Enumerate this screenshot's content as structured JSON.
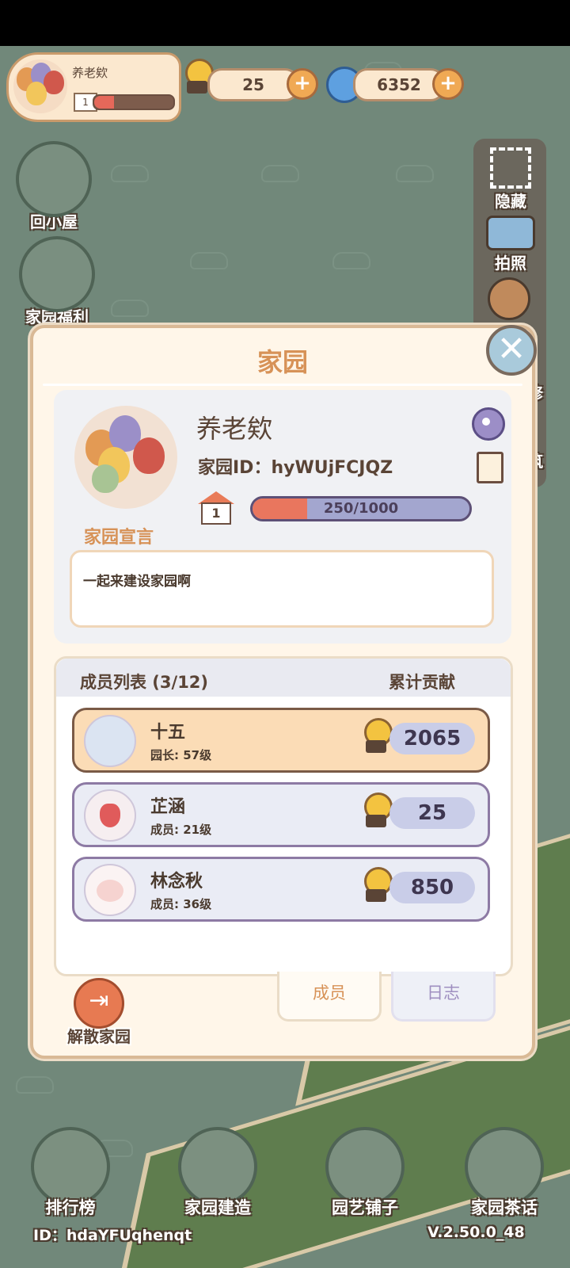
{
  "colors": {
    "accent": "#d79257",
    "leader_row": "#fbdcb6",
    "member_row": "#eaecf5",
    "exp_fill": "#e9765e"
  },
  "hud": {
    "profile_name": "养老欸",
    "profile_level": "1",
    "profile_progress": 0.25,
    "snail_currency": "25",
    "spiral_currency": "6352",
    "plus": "+"
  },
  "side_left": {
    "home": "回小屋",
    "welfare": "家园福利"
  },
  "side_right": {
    "hide": "隐藏",
    "photo": "拍照",
    "repair_partial": "修",
    "build_partial": "筑"
  },
  "dialog": {
    "title": "家园",
    "close": "✕",
    "garden_name": "养老欸",
    "garden_id_label": "家园ID：",
    "garden_id": "hyWUjFCJQZ",
    "level": "1",
    "exp_text": "250/1000",
    "exp_fraction": 0.25,
    "declaration_label": "家园宣言",
    "declaration_text": "一起来建设家园啊",
    "members_title": "成员列表 (3/12)",
    "contribution_header": "累计贡献",
    "members": [
      {
        "name": "十五",
        "role": "园长: 57级",
        "contribution": "2065",
        "avatar_icon": "bunny-with-flowers-icon"
      },
      {
        "name": "芷涵",
        "role": "成员: 21级",
        "contribution": "25",
        "avatar_icon": "strawberry-icon"
      },
      {
        "name": "林念秋",
        "role": "成员: 36级",
        "contribution": "850",
        "avatar_icon": "bunny-face-icon"
      }
    ],
    "tabs": {
      "members": "成员",
      "log": "日志"
    },
    "dissolve": "解散家园"
  },
  "bottom_nav": {
    "ranking": "排行榜",
    "build": "家园建造",
    "shop": "园艺铺子",
    "chat": "家园茶话"
  },
  "footer": {
    "id": "ID：hdaYFUqhenqt",
    "version": "V.2.50.0_48"
  }
}
